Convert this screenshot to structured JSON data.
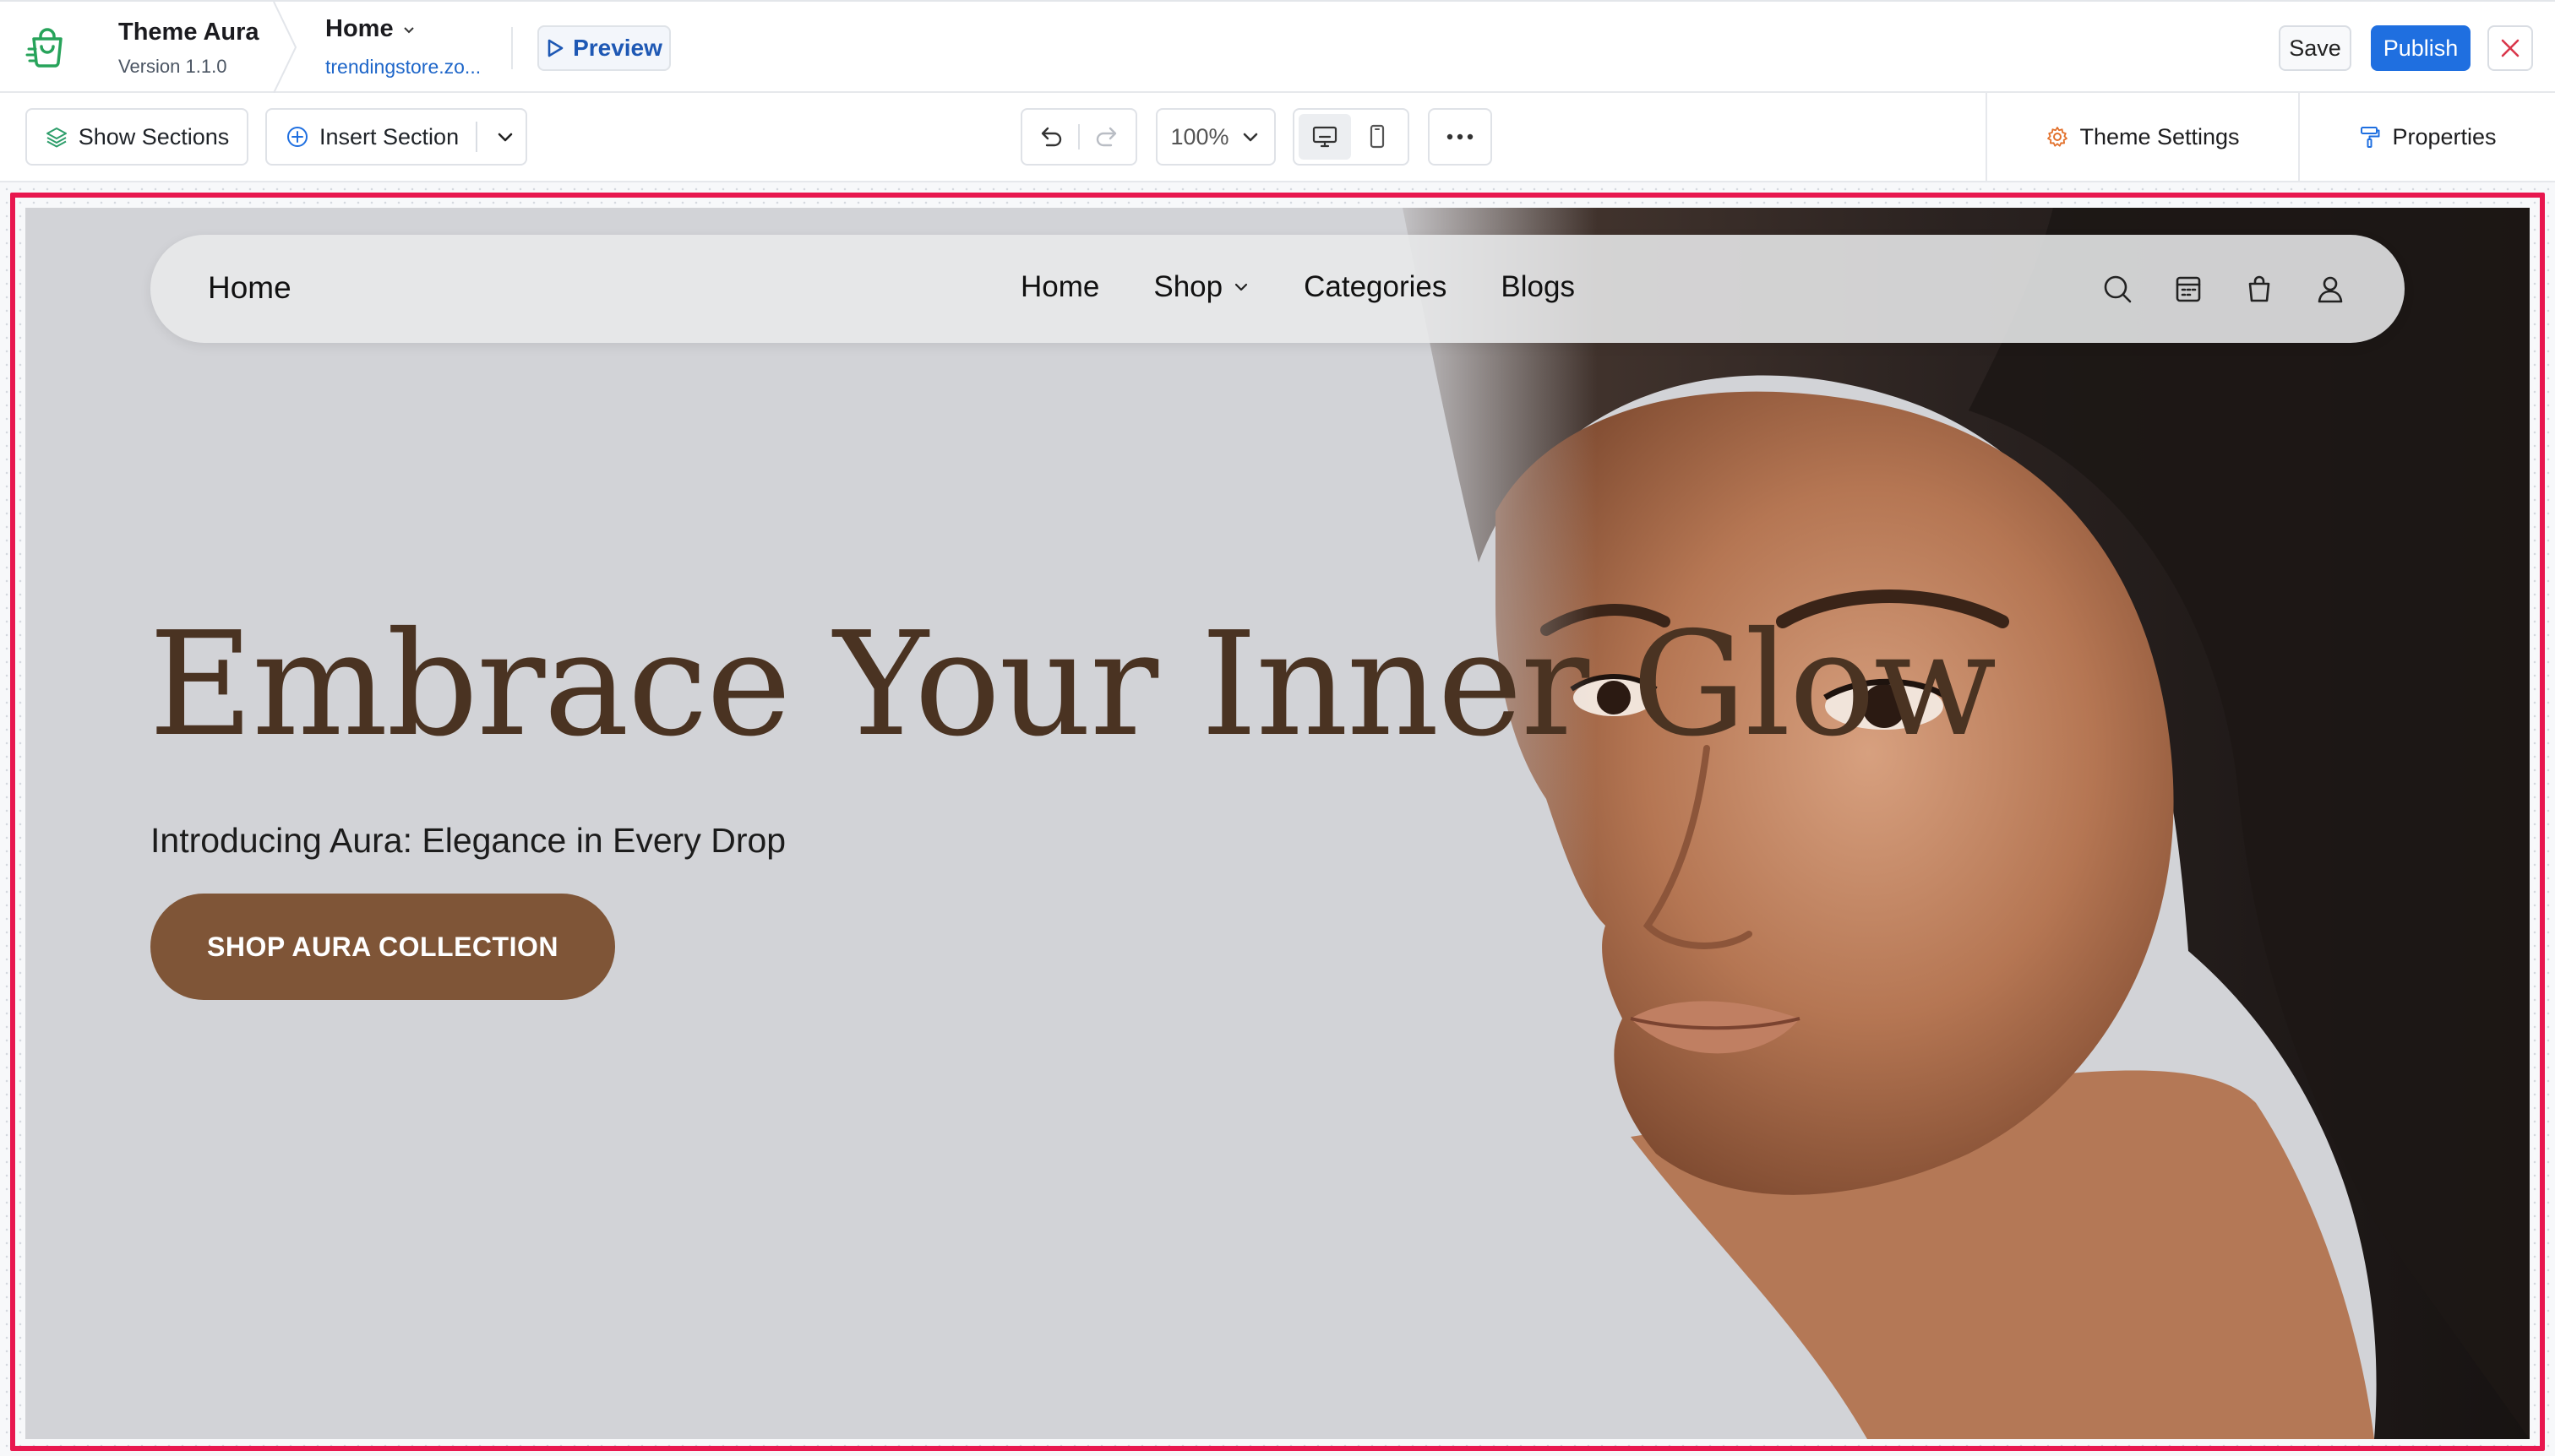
{
  "app": {
    "theme_name": "Theme Aura",
    "theme_version": "Version 1.1.0",
    "page_name": "Home",
    "page_url": "trendingstore.zo...",
    "preview_label": "Preview",
    "save_label": "Save",
    "publish_label": "Publish",
    "icon": "shopping-bag-icon"
  },
  "toolbar": {
    "show_sections_label": "Show Sections",
    "insert_section_label": "Insert Section",
    "zoom_value": "100%",
    "theme_settings_label": "Theme Settings",
    "properties_label": "Properties",
    "active_device": "desktop"
  },
  "site": {
    "logo_text": "Home",
    "nav": [
      {
        "label": "Home"
      },
      {
        "label": "Shop",
        "has_dropdown": true
      },
      {
        "label": "Categories"
      },
      {
        "label": "Blogs"
      }
    ],
    "icons": [
      "search-icon",
      "calendar-icon",
      "bag-icon",
      "user-icon"
    ]
  },
  "hero": {
    "title": "Embrace Your Inner Glow",
    "subtitle": "Introducing Aura: Elegance in Every Drop",
    "cta_label": "SHOP AURA COLLECTION"
  },
  "colors": {
    "primary": "#1f6fe0",
    "selection": "#e8174f",
    "hero_bg": "#d2d3d7",
    "title": "#4a3322",
    "cta": "#7f5537"
  }
}
